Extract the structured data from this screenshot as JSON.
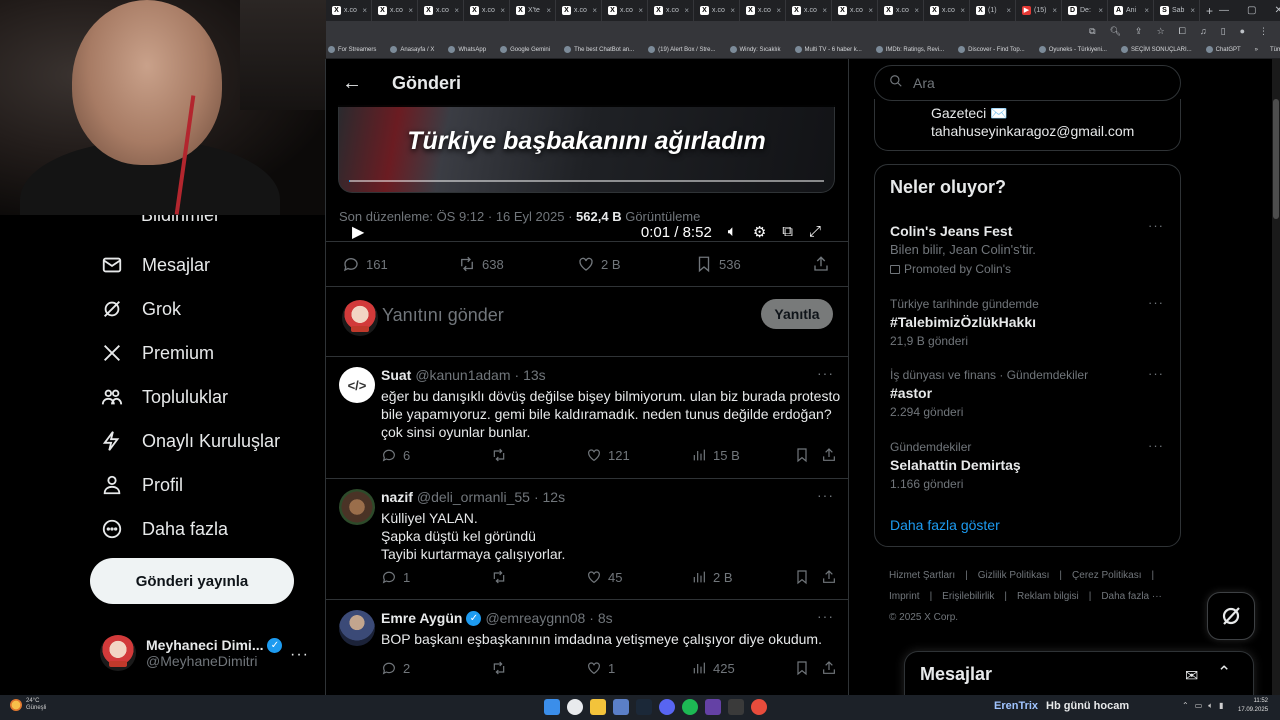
{
  "browser": {
    "tabs": [
      {
        "label": "x.co",
        "fav": "X"
      },
      {
        "label": "x.co",
        "fav": "X"
      },
      {
        "label": "x.co",
        "fav": "X"
      },
      {
        "label": "x.co",
        "fav": "X"
      },
      {
        "label": "X'te",
        "fav": "X"
      },
      {
        "label": "x.co",
        "fav": "X"
      },
      {
        "label": "x.co",
        "fav": "X"
      },
      {
        "label": "x.co",
        "fav": "X"
      },
      {
        "label": "x.co",
        "fav": "X"
      },
      {
        "label": "x.co",
        "fav": "X"
      },
      {
        "label": "x.co",
        "fav": "X"
      },
      {
        "label": "x.co",
        "fav": "X"
      },
      {
        "label": "x.co",
        "fav": "X"
      },
      {
        "label": "x.co",
        "fav": "X"
      },
      {
        "label": "(1)",
        "fav": "X"
      },
      {
        "label": "(15)",
        "fav": "▶"
      },
      {
        "label": "De:",
        "fav": "D"
      },
      {
        "label": "Ani",
        "fav": "A"
      },
      {
        "label": "Sab",
        "fav": "S"
      }
    ],
    "bookmarks": [
      "For Streamers",
      "Anasayfa / X",
      "WhatsApp",
      "Google Gemini",
      "The best ChatBot an...",
      "(19) Alert Box / Stre...",
      "Windy: Sıcaklık",
      "Multi TV - 6 haber k...",
      "IMDb: Ratings, Revi...",
      "Discover - Find Top...",
      "Oyuneks - Türkiyeni...",
      "SEÇİM SONUÇLARI...",
      "ChatGPT"
    ],
    "bookmarks_more": "»",
    "all_bookmarks": "Tüm Yer İşaretleri"
  },
  "nav": {
    "clipped_label": "Bildirimler",
    "items": [
      {
        "label": "Mesajlar",
        "icon": "mail-icon"
      },
      {
        "label": "Grok",
        "icon": "grok-icon"
      },
      {
        "label": "Premium",
        "icon": "x-logo-icon"
      },
      {
        "label": "Topluluklar",
        "icon": "communities-icon"
      },
      {
        "label": "Onaylı Kuruluşlar",
        "icon": "lightning-icon"
      },
      {
        "label": "Profil",
        "icon": "person-icon"
      },
      {
        "label": "Daha fazla",
        "icon": "more-circle-icon"
      }
    ],
    "post_button": "Gönderi yayınla",
    "account_name": "Meyhaneci Dimi...",
    "account_handle": "@MeyhaneDimitri",
    "account_more": "···"
  },
  "main": {
    "header_title": "Gönderi",
    "video": {
      "caption": "Türkiye başbakanını ağırladım",
      "time": "0:01 / 8:52",
      "progress": 0.002
    },
    "meta": {
      "edited": "Son düzenleme: ÖS 9:12 · 16 Eyl 2025 ·",
      "views_count": "562,4 B",
      "views_label": "Görüntüleme"
    },
    "actions": {
      "replies": "161",
      "reposts": "638",
      "likes": "2 B",
      "bookmarks": "536"
    },
    "reply_placeholder": "Yanıtını gönder",
    "reply_button": "Yanıtla",
    "replies": [
      {
        "name": "Suat",
        "handle": "@kanun1adam",
        "time": "· 13s",
        "verified": false,
        "avatar_text": "</>",
        "lines": [
          "eğer bu danışıklı dövüş değilse bişey bilmiyorum. ulan biz burada protesto",
          "bile yapamıyoruz. gemi bile kaldıramadık. neden tunus değilde erdoğan?",
          "çok sinsi oyunlar bunlar."
        ],
        "replies": "6",
        "reposts": "",
        "likes": "121",
        "views": "15 B"
      },
      {
        "name": "nazif",
        "handle": "@deli_ormanli_55",
        "time": "· 12s",
        "verified": false,
        "avatar_text": "",
        "lines": [
          "Külliyel YALAN.",
          "Şapka düştü kel göründü",
          "Tayibi kurtarmaya çalışıyorlar."
        ],
        "replies": "1",
        "reposts": "",
        "likes": "45",
        "views": "2 B"
      },
      {
        "name": "Emre Aygün",
        "handle": "@emreaygnn08",
        "time": "· 8s",
        "verified": true,
        "avatar_text": "",
        "lines": [
          "BOP başkanı eşbaşkanının imdadına yetişmeye çalışıyor diye okudum."
        ],
        "replies": "2",
        "reposts": "",
        "likes": "1",
        "views": "425"
      }
    ]
  },
  "sidebar": {
    "search_placeholder": "Ara",
    "profile_line1": "Gazeteci ✉️",
    "profile_line2": "tahahuseyinkaragoz@gmail.com",
    "trends_title": "Neler oluyor?",
    "trends": [
      {
        "context": "",
        "title": "Colin's Jeans Fest",
        "subtitle": "Bilen bilir, Jean Colin's'tir.",
        "count": "",
        "promo": "Promoted by Colin's"
      },
      {
        "context": "Türkiye tarihinde gündemde",
        "title": "#TalebimizÖzlükHakkı",
        "subtitle": "",
        "count": "21,9 B gönderi",
        "promo": ""
      },
      {
        "context": "İş dünyası ve finans · Gündemdekiler",
        "title": "#astor",
        "subtitle": "",
        "count": "2.294 gönderi",
        "promo": ""
      },
      {
        "context": "Gündemdekiler",
        "title": "Selahattin Demirtaş",
        "subtitle": "",
        "count": "1.166 gönderi",
        "promo": ""
      }
    ],
    "show_more": "Daha fazla göster",
    "footer": [
      "Hizmet Şartları",
      "|",
      "Gizlilik Politikası",
      "|",
      "Çerez Politikası",
      "|",
      "Imprint",
      "|",
      "Erişilebilirlik",
      "|",
      "Reklam bilgisi",
      "|",
      "Daha fazla ···",
      "© 2025 X Corp."
    ],
    "messages_title": "Mesajlar"
  },
  "taskbar": {
    "weather_temp": "24°C",
    "weather_desc": "Güneşli",
    "stream_channel": "ErenTrix",
    "stream_title": "Hb günü hocam",
    "clock_time": "11:52",
    "clock_date": "17.09.2025"
  },
  "colors": {
    "accent": "#1d9bf0",
    "background": "#000000",
    "text": "#e7e9ea",
    "muted": "#71767b",
    "border": "#2f3336"
  }
}
